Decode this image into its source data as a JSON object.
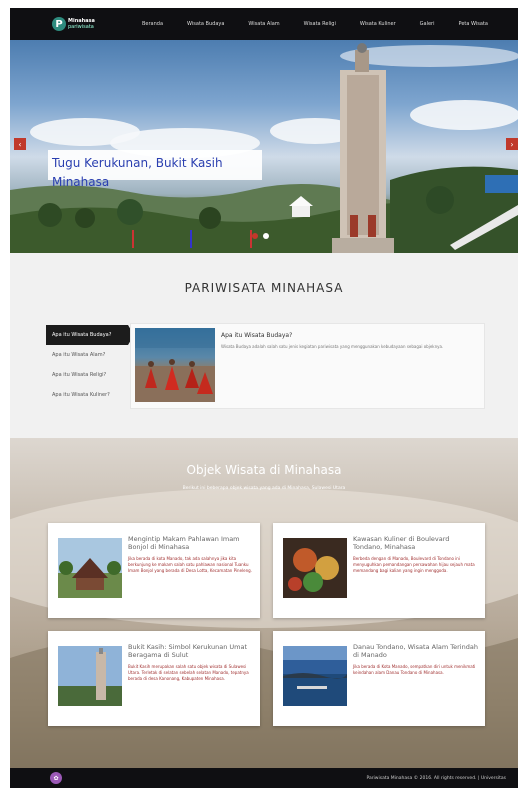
{
  "logo": {
    "mark": "P",
    "line1": "Minahasa",
    "line2": "pariwisata"
  },
  "nav": {
    "items": [
      "Beranda",
      "Wisata Budaya",
      "Wisata Alam",
      "Wisata Religi",
      "Wisata Kuliner",
      "Galeri",
      "Peta Wisata"
    ]
  },
  "hero": {
    "caption": "Tugu Kerukunan, Bukit Kasih Minahasa",
    "prev_icon": "chevron-left-icon",
    "next_icon": "chevron-right-icon",
    "slide_count": 2,
    "active_slide": 1
  },
  "pariwisata": {
    "title": "PARIWISATA MINAHASA",
    "tabs": [
      "Apa itu Wisata Budaya?",
      "Apa itu Wisata Alam?",
      "Apa itu Wisata Religi?",
      "Apa itu Wisata Kuliner?"
    ],
    "active_tab": 0,
    "panel_title": "Apa itu Wisata Budaya?",
    "panel_text": "Wisata Budaya adalah salah satu jenis kegiatan pariwisata yang menggunakan kebudayaan sebagai objeknya."
  },
  "objek": {
    "title": "Objek Wisata di Minahasa",
    "subtitle": "Berikut ini beberapa objek wisata yang ada di Minahasa, Sulawesi Utara",
    "cards": [
      {
        "title": "Mengintip Makam Pahlawan Imam Bonjol di Minahasa",
        "text": "Jika berada di kota Manado, tak ada salahnya jika kita berkunjung ke makam salah satu pahlawan nasional Tuanku Imam Bonjol yang berada di Desa Lotta, Kecamatan Pineleng."
      },
      {
        "title": "Kawasan Kuliner di Boulevard Tondano, Minahasa",
        "text": "Berbeda dengan di Manado, Boulevard di Tondano ini menyuguhkan pemandangan persawahan hijau sejauh mata memandang bagi kalian yang ingin menggoda."
      },
      {
        "title": "Bukit Kasih: Simbol Kerukunan Umat Beragama di Sulut",
        "text": "Bukit Kasih merupakan salah satu objek wisata di Sulawesi Utara. Terletak di selatan sebelah selatan Manado, tepatnya berada di desa Kanonang, Kabupaten Minahasa."
      },
      {
        "title": "Danau Tondano, Wisata Alam Terindah di Manado",
        "text": "Jika berada di Kota Manado, sempatkan diri untuk menikmati keindahan alam Danau Tondano di Minahasa."
      }
    ]
  },
  "footer": {
    "icon": "flower-icon",
    "text": "Pariwisata Minahasa © 2016. All rights reserved. | Universitas"
  },
  "colors": {
    "accent": "#c0392b",
    "nav_bg": "#0f0f12",
    "caption_text": "#2a3fb0"
  }
}
